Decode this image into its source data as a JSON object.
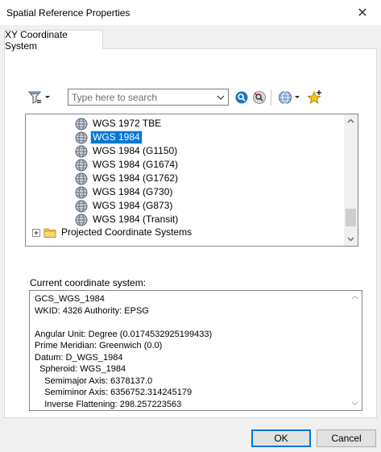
{
  "window": {
    "title": "Spatial Reference Properties",
    "close_glyph": "✕"
  },
  "tabs": [
    {
      "label": "XY Coordinate System",
      "active": true
    }
  ],
  "toolbar": {
    "filter_icon": "filter-icon",
    "search_placeholder": "Type here to search",
    "search_value": "",
    "search_icon": "search-icon",
    "clear_search_icon": "clear-search-icon",
    "globe_icon": "globe-icon",
    "add_favorite_icon": "add-to-favorites-icon"
  },
  "tree": {
    "items": [
      {
        "label": "WGS 1972 TBE",
        "type": "gcs",
        "selected": false
      },
      {
        "label": "WGS 1984",
        "type": "gcs",
        "selected": true
      },
      {
        "label": "WGS 1984 (G1150)",
        "type": "gcs",
        "selected": false
      },
      {
        "label": "WGS 1984 (G1674)",
        "type": "gcs",
        "selected": false
      },
      {
        "label": "WGS 1984 (G1762)",
        "type": "gcs",
        "selected": false
      },
      {
        "label": "WGS 1984 (G730)",
        "type": "gcs",
        "selected": false
      },
      {
        "label": "WGS 1984 (G873)",
        "type": "gcs",
        "selected": false
      },
      {
        "label": "WGS 1984 (Transit)",
        "type": "gcs",
        "selected": false
      }
    ],
    "folder": {
      "label": "Projected Coordinate Systems",
      "expand_glyph": "+"
    },
    "scroll_fraction": 0.93
  },
  "current": {
    "label": "Current coordinate system:",
    "lines": [
      "GCS_WGS_1984",
      "WKID: 4326 Authority: EPSG",
      "",
      "Angular Unit: Degree (0.0174532925199433)",
      "Prime Meridian: Greenwich (0.0)",
      "Datum: D_WGS_1984",
      "  Spheroid: WGS_1984",
      "    Semimajor Axis: 6378137.0",
      "    Semiminor Axis: 6356752.314245179",
      "    Inverse Flattening: 298.257223563"
    ]
  },
  "buttons": {
    "ok": "OK",
    "cancel": "Cancel"
  },
  "colors": {
    "selection": "#0078d7",
    "dialog_bg": "#f0f0f0",
    "default_button_border": "#0078d7"
  }
}
